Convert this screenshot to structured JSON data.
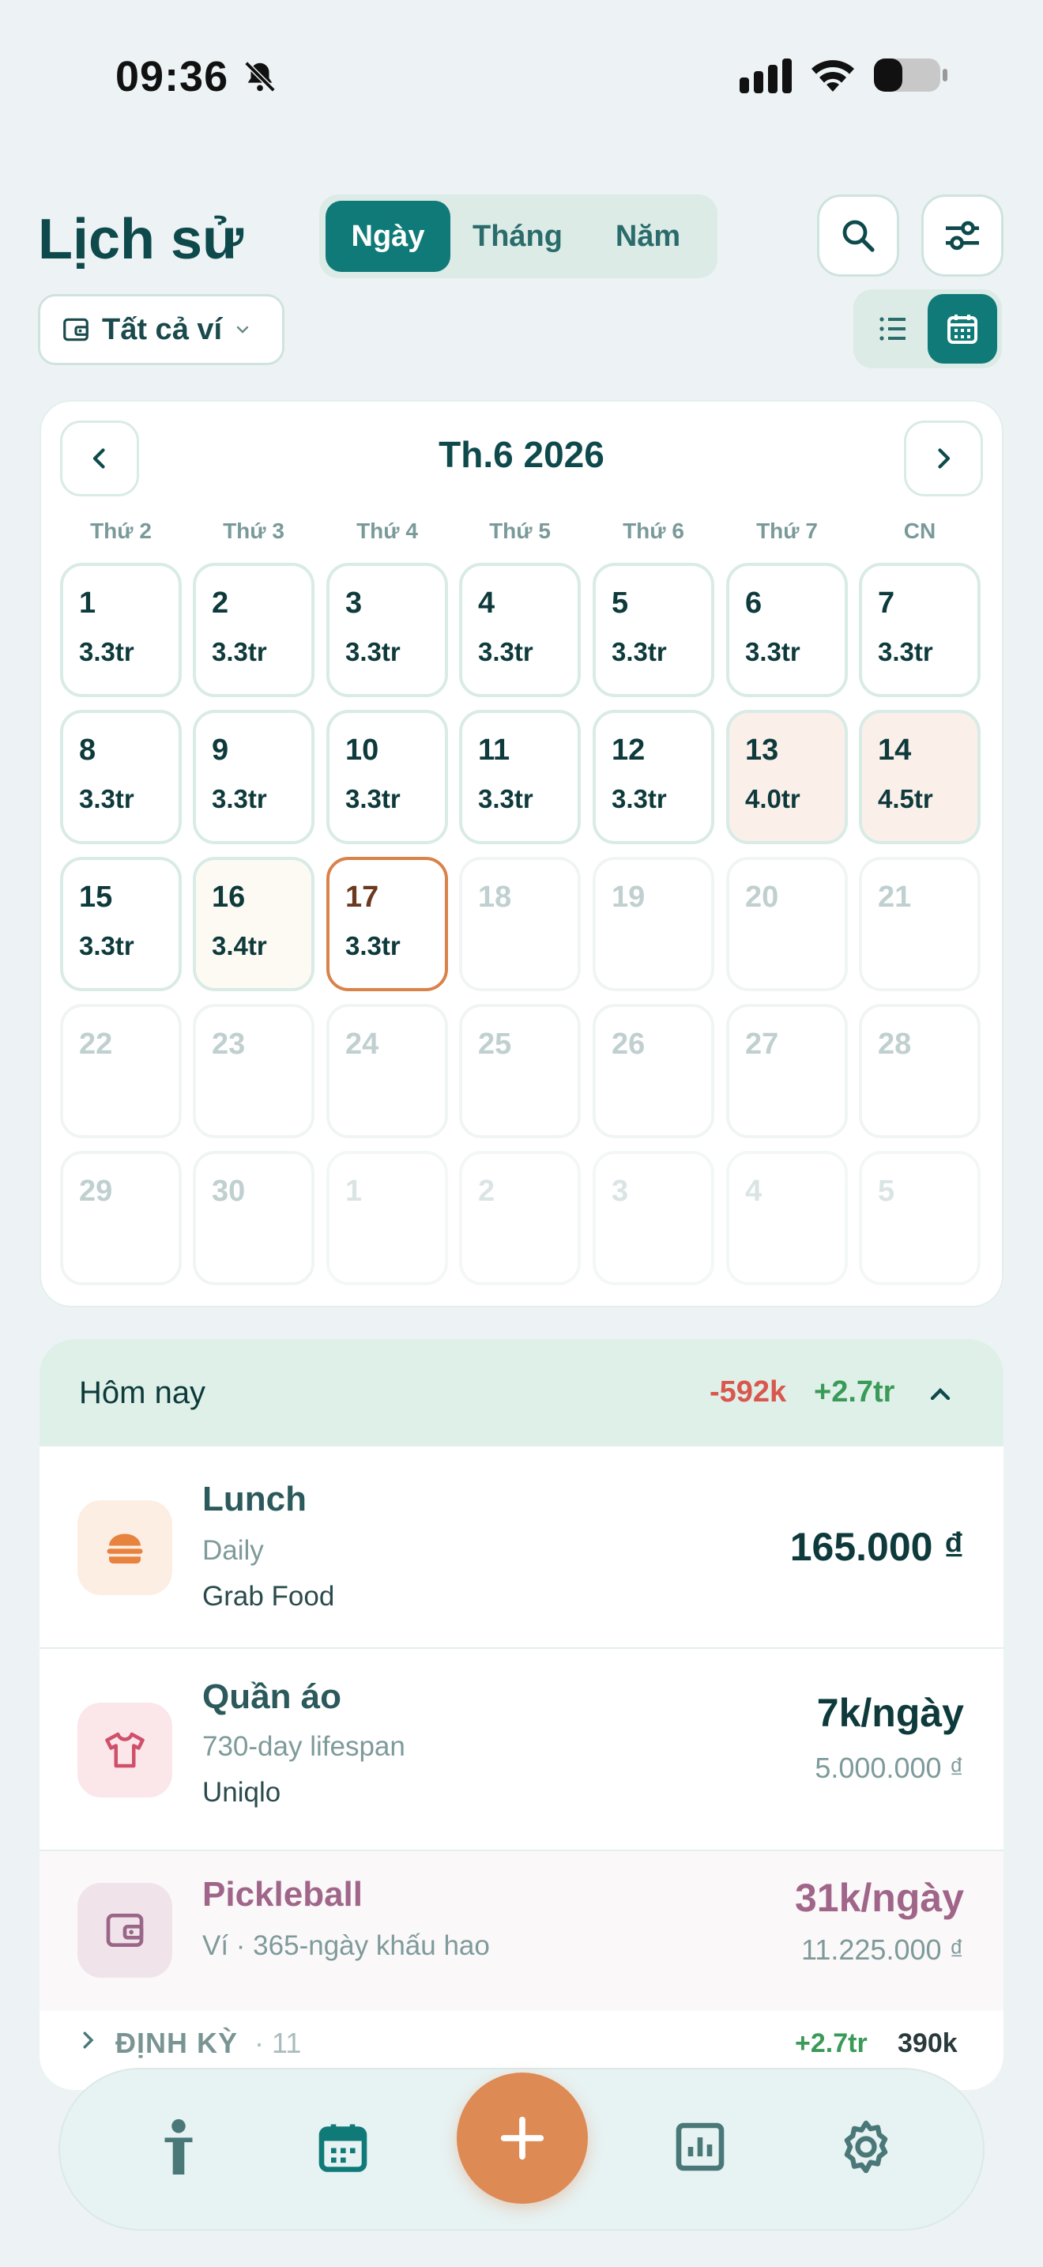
{
  "status": {
    "time": "09:36"
  },
  "header": {
    "title": "Lịch sử",
    "tabs": [
      {
        "label": "Ngày",
        "active": true
      },
      {
        "label": "Tháng",
        "active": false
      },
      {
        "label": "Năm",
        "active": false
      }
    ],
    "wallet_filter": "Tất cả ví",
    "icons": [
      "search-icon",
      "filter-sliders-icon",
      "list-view-icon",
      "calendar-view-icon"
    ],
    "active_view": "calendar"
  },
  "calendar": {
    "month_label": "Th.6 2026",
    "weekdays": [
      "Thứ 2",
      "Thứ 3",
      "Thứ 4",
      "Thứ 5",
      "Thứ 6",
      "Thứ 7",
      "CN"
    ],
    "today": "17",
    "cells": [
      {
        "day": "1",
        "value": "3.3tr",
        "state": "past"
      },
      {
        "day": "2",
        "value": "3.3tr",
        "state": "past"
      },
      {
        "day": "3",
        "value": "3.3tr",
        "state": "past"
      },
      {
        "day": "4",
        "value": "3.3tr",
        "state": "past"
      },
      {
        "day": "5",
        "value": "3.3tr",
        "state": "past"
      },
      {
        "day": "6",
        "value": "3.3tr",
        "state": "past"
      },
      {
        "day": "7",
        "value": "3.3tr",
        "state": "past"
      },
      {
        "day": "8",
        "value": "3.3tr",
        "state": "past"
      },
      {
        "day": "9",
        "value": "3.3tr",
        "state": "past"
      },
      {
        "day": "10",
        "value": "3.3tr",
        "state": "past"
      },
      {
        "day": "11",
        "value": "3.3tr",
        "state": "past"
      },
      {
        "day": "12",
        "value": "3.3tr",
        "state": "past"
      },
      {
        "day": "13",
        "value": "4.0tr",
        "state": "high"
      },
      {
        "day": "14",
        "value": "4.5tr",
        "state": "high"
      },
      {
        "day": "15",
        "value": "3.3tr",
        "state": "past"
      },
      {
        "day": "16",
        "value": "3.4tr",
        "state": "mid"
      },
      {
        "day": "17",
        "value": "3.3tr",
        "state": "today"
      },
      {
        "day": "18",
        "value": "",
        "state": "future"
      },
      {
        "day": "19",
        "value": "",
        "state": "future"
      },
      {
        "day": "20",
        "value": "",
        "state": "future"
      },
      {
        "day": "21",
        "value": "",
        "state": "future"
      },
      {
        "day": "22",
        "value": "",
        "state": "future"
      },
      {
        "day": "23",
        "value": "",
        "state": "future"
      },
      {
        "day": "24",
        "value": "",
        "state": "future"
      },
      {
        "day": "25",
        "value": "",
        "state": "future"
      },
      {
        "day": "26",
        "value": "",
        "state": "future"
      },
      {
        "day": "27",
        "value": "",
        "state": "future"
      },
      {
        "day": "28",
        "value": "",
        "state": "future"
      },
      {
        "day": "29",
        "value": "",
        "state": "future"
      },
      {
        "day": "30",
        "value": "",
        "state": "future"
      },
      {
        "day": "1",
        "value": "",
        "state": "next"
      },
      {
        "day": "2",
        "value": "",
        "state": "next"
      },
      {
        "day": "3",
        "value": "",
        "state": "next"
      },
      {
        "day": "4",
        "value": "",
        "state": "next"
      },
      {
        "day": "5",
        "value": "",
        "state": "next"
      }
    ]
  },
  "today_section": {
    "label": "Hôm nay",
    "expense": "-592k",
    "income": "+2.7tr",
    "items": [
      {
        "name": "Lunch",
        "sub": "Daily",
        "detail": "Grab Food",
        "amount": "165.000 ₫",
        "icon": "burger-icon"
      },
      {
        "name": "Quần áo",
        "sub": "730-day lifespan",
        "detail": "Uniqlo",
        "amount": "7k/ngày",
        "amount_sub": "5.000.000 ₫",
        "icon": "tshirt-icon"
      },
      {
        "name": "Pickleball",
        "sub": "Ví · 365-ngày khấu hao",
        "amount": "31k/ngày",
        "amount_sub": "11.225.000 ₫",
        "icon": "wallet-icon"
      }
    ],
    "recurring": {
      "label": "ĐỊNH KỲ",
      "count": "· 11",
      "income": "+2.7tr",
      "expense": "390k"
    }
  },
  "colors": {
    "primary": "#0f7a78",
    "accent": "#de8a55",
    "expense": "#d9574e",
    "income": "#3a9a58"
  },
  "nav": {
    "items": [
      "person-icon",
      "calendar-icon",
      "add-icon",
      "bar-chart-icon",
      "settings-icon"
    ],
    "active": "calendar-icon"
  }
}
